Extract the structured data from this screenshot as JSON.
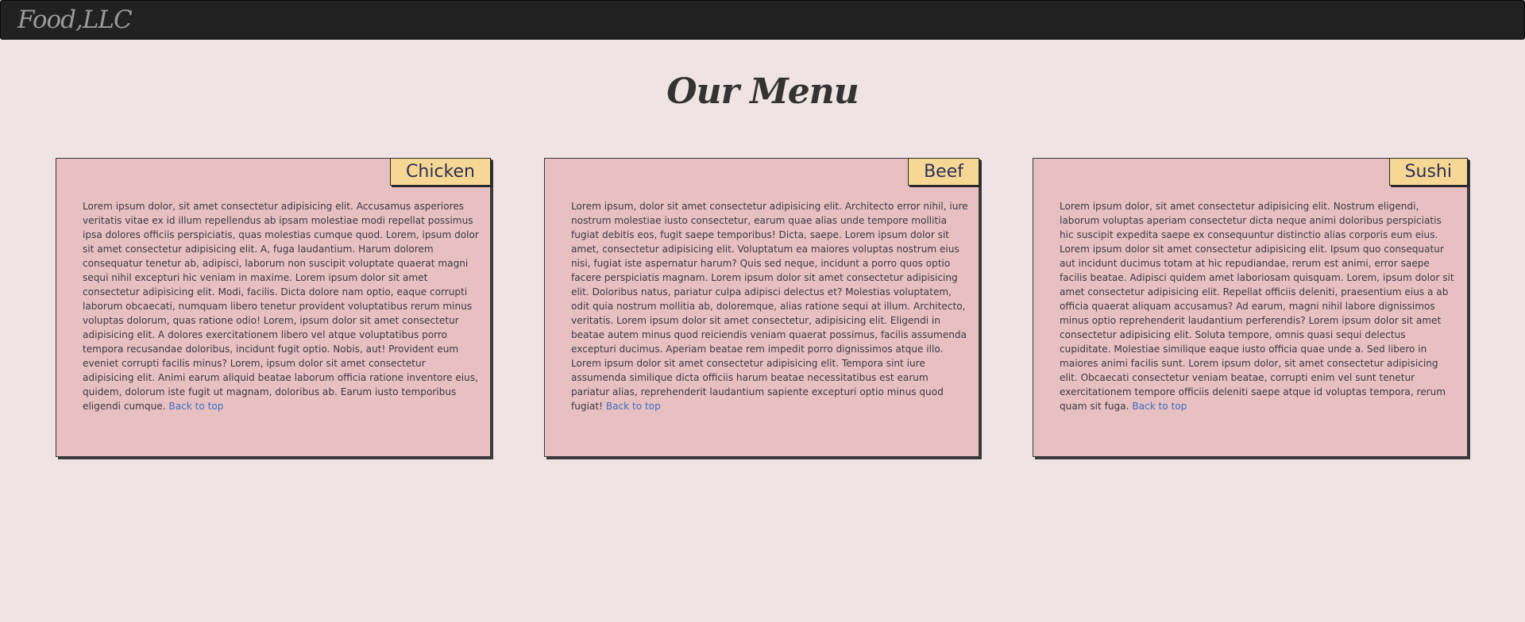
{
  "navbar": {
    "brand": "Food,LLC"
  },
  "page": {
    "title": "Our Menu"
  },
  "cards": [
    {
      "tag": "Chicken",
      "text": "Lorem ipsum dolor, sit amet consectetur adipisicing elit. Accusamus asperiores veritatis vitae ex id illum repellendus ab ipsam molestiae modi repellat possimus ipsa dolores officiis perspiciatis, quas molestias cumque quod. Lorem, ipsum dolor sit amet consectetur adipisicing elit. A, fuga laudantium. Harum dolorem consequatur tenetur ab, adipisci, laborum non suscipit voluptate quaerat magni sequi nihil excepturi hic veniam in maxime. Lorem ipsum dolor sit amet consectetur adipisicing elit. Modi, facilis. Dicta dolore nam optio, eaque corrupti laborum obcaecati, numquam libero tenetur provident voluptatibus rerum minus voluptas dolorum, quas ratione odio! Lorem, ipsum dolor sit amet consectetur adipisicing elit. A dolores exercitationem libero vel atque voluptatibus porro tempora recusandae doloribus, incidunt fugit optio. Nobis, aut! Provident eum eveniet corrupti facilis minus? Lorem, ipsum dolor sit amet consectetur adipisicing elit. Animi earum aliquid beatae laborum officia ratione inventore eius, quidem, dolorum iste fugit ut magnam, doloribus ab. Earum iusto temporibus eligendi cumque.",
      "link": "Back to top"
    },
    {
      "tag": "Beef",
      "text": "Lorem ipsum, dolor sit amet consectetur adipisicing elit. Architecto error nihil, iure nostrum molestiae iusto consectetur, earum quae alias unde tempore mollitia fugiat debitis eos, fugit saepe temporibus! Dicta, saepe. Lorem ipsum dolor sit amet, consectetur adipisicing elit. Voluptatum ea maiores voluptas nostrum eius nisi, fugiat iste aspernatur harum? Quis sed neque, incidunt a porro quos optio facere perspiciatis magnam. Lorem ipsum dolor sit amet consectetur adipisicing elit. Doloribus natus, pariatur culpa adipisci delectus et? Molestias voluptatem, odit quia nostrum mollitia ab, doloremque, alias ratione sequi at illum. Architecto, veritatis. Lorem ipsum dolor sit amet consectetur, adipisicing elit. Eligendi in beatae autem minus quod reiciendis veniam quaerat possimus, facilis assumenda excepturi ducimus. Aperiam beatae rem impedit porro dignissimos atque illo. Lorem ipsum dolor sit amet consectetur adipisicing elit. Tempora sint iure assumenda similique dicta officiis harum beatae necessitatibus est earum pariatur alias, reprehenderit laudantium sapiente excepturi optio minus quod fugiat!",
      "link": "Back to top"
    },
    {
      "tag": "Sushi",
      "text": "Lorem ipsum dolor, sit amet consectetur adipisicing elit. Nostrum eligendi, laborum voluptas aperiam consectetur dicta neque animi doloribus perspiciatis hic suscipit expedita saepe ex consequuntur distinctio alias corporis eum eius. Lorem ipsum dolor sit amet consectetur adipisicing elit. Ipsum quo consequatur aut incidunt ducimus totam at hic repudiandae, rerum est animi, error saepe facilis beatae. Adipisci quidem amet laboriosam quisquam. Lorem, ipsum dolor sit amet consectetur adipisicing elit. Repellat officiis deleniti, praesentium eius a ab officia quaerat aliquam accusamus? Ad earum, magni nihil labore dignissimos minus optio reprehenderit laudantium perferendis? Lorem ipsum dolor sit amet consectetur adipisicing elit. Soluta tempore, omnis quasi sequi delectus cupiditate. Molestiae similique eaque iusto officia quae unde a. Sed libero in maiores animi facilis sunt. Lorem ipsum dolor, sit amet consectetur adipisicing elit. Obcaecati consectetur veniam beatae, corrupti enim vel sunt tenetur exercitationem tempore officiis deleniti saepe atque id voluptas tempora, rerum quam sit fuga.",
      "link": "Back to top"
    }
  ]
}
